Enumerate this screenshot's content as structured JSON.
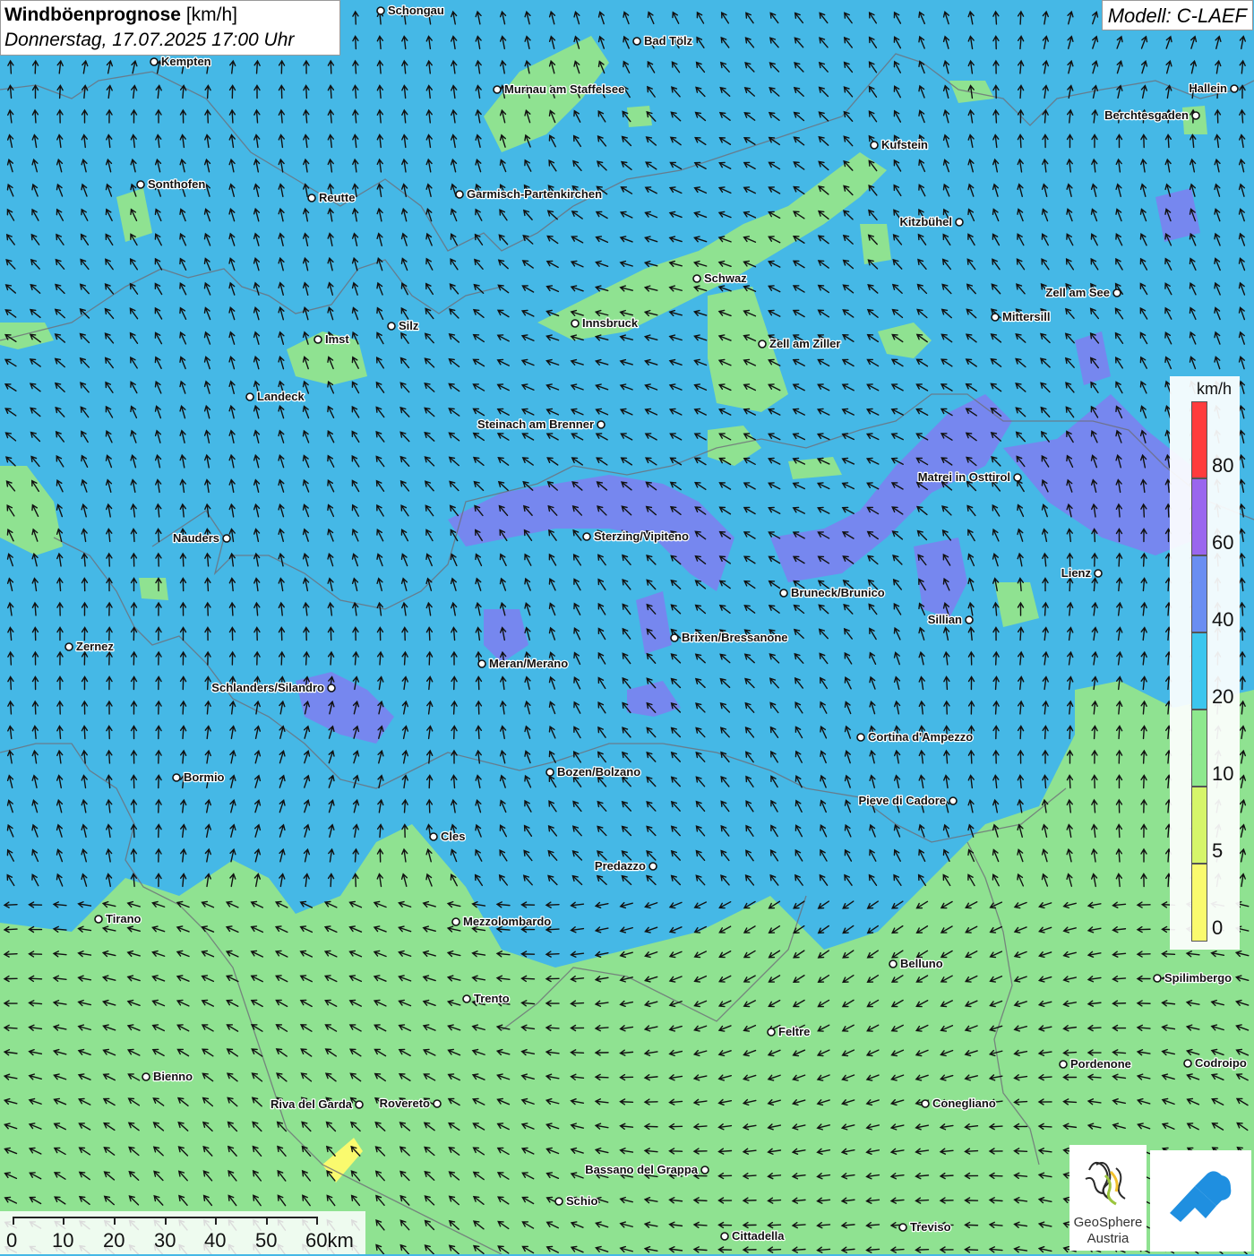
{
  "title": {
    "main": "Windböenprognose",
    "unit": "[km/h]",
    "datetime": "Donnerstag, 17.07.2025 17:00 Uhr"
  },
  "model_label": "Modell: C-LAEF",
  "legend": {
    "unit": "km/h",
    "labels": [
      "80",
      "60",
      "40",
      "20",
      "10",
      "5",
      "0"
    ],
    "colors": {
      "c0_5": "#fafa6e",
      "c5_10": "#d6f56a",
      "c10_20": "#8ee88e",
      "c20_40": "#3cc6ee",
      "c40_60": "#6a8ef2",
      "c60_80": "#9a66ee",
      "c80_plus": "#ff3c3c"
    }
  },
  "scalebar": {
    "labels": [
      "0",
      "10",
      "20",
      "30",
      "40",
      "50",
      "60km"
    ]
  },
  "logos": {
    "geosphere_line1": "GeoSphere",
    "geosphere_line2": "Austria"
  },
  "map_colors": {
    "sea_blue": "#45b8e6",
    "calm_green": "#8fe291",
    "strong_purple": "#7f7ef0",
    "border_gray": "#6e6e78",
    "arrow": "#111111"
  },
  "cities": [
    "Schongau",
    "Bad Tölz",
    "Kempten",
    "Murnau am Staffelsee",
    "Hallein",
    "Berchtesgaden",
    "Kufstein",
    "Sonthofen",
    "Reutte",
    "Garmisch-Partenkirchen",
    "Kitzbühel",
    "Schwaz",
    "Zell am See",
    "Mittersill",
    "Innsbruck",
    "Imst",
    "Silz",
    "Zell am Ziller",
    "Landeck",
    "Steinach am Brenner",
    "Matrei in Osttirol",
    "Nauders",
    "Sterzing/Vipiteno",
    "Lienz",
    "Bruneck/Brunico",
    "Sillian",
    "Zernez",
    "Brixen/Bressanone",
    "Meran/Merano",
    "Schlanders/Silandro",
    "Cortina d'Ampezzo",
    "Bormio",
    "Bozen/Bolzano",
    "Pieve di Cadore",
    "Cles",
    "Predazzo",
    "Tirano",
    "Mezzolombardo",
    "Belluno",
    "Spilimbergo",
    "Trento",
    "Feltre",
    "Bienno",
    "Pordenone",
    "Codroipo",
    "Riva del Garda",
    "Rovereto",
    "Conegliano",
    "Bassano del Grappa",
    "Schio",
    "Treviso",
    "Cittadella"
  ]
}
